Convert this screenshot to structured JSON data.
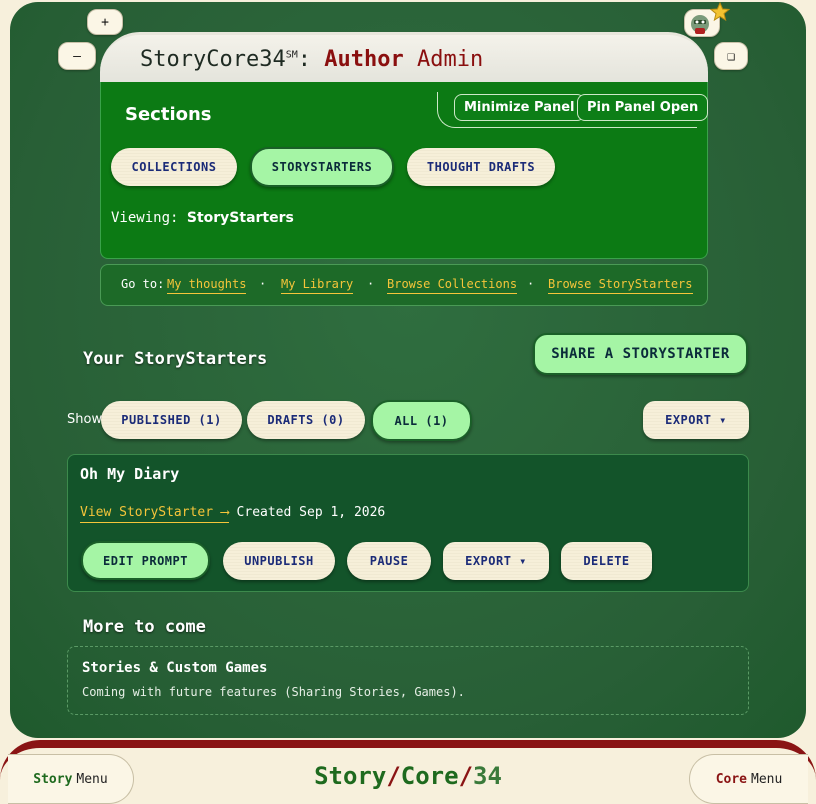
{
  "window": {
    "zoom_in": "+",
    "zoom_out": "–",
    "restore": "❑"
  },
  "header": {
    "brand": "StoryCore34",
    "brand_mark": "SM",
    "separator": ":",
    "role_word1": "Author",
    "role_word2": "Admin"
  },
  "panel": {
    "heading": "Sections",
    "minimize_label": "Minimize Panel",
    "pin_label": "Pin Panel Open",
    "tabs": [
      {
        "label": "COLLECTIONS",
        "active": false
      },
      {
        "label": "STORYSTARTERS",
        "active": true
      },
      {
        "label": "THOUGHT DRAFTS",
        "active": false
      }
    ],
    "viewing_label": "Viewing:",
    "viewing_value": "StoryStarters"
  },
  "goto": {
    "label": "Go to:",
    "links": [
      "My thoughts",
      "My Library",
      "Browse Collections",
      "Browse StoryStarters"
    ],
    "sep": "·"
  },
  "storystarters": {
    "heading": "Your StoryStarters",
    "share_label": "SHARE A STORYSTARTER",
    "show_label": "Show",
    "filters": [
      {
        "label": "PUBLISHED (1)",
        "active": false
      },
      {
        "label": "DRAFTS (0)",
        "active": false
      },
      {
        "label": "ALL (1)",
        "active": true
      }
    ],
    "export_label": "EXPORT ▾",
    "items": [
      {
        "title": "Oh My Diary",
        "view_link": "View StoryStarter ⟶",
        "created": "Created Sep 1, 2026",
        "actions": {
          "edit": "EDIT PROMPT",
          "unpublish": "UNPUBLISH",
          "pause": "PAUSE",
          "export": "EXPORT ▾",
          "delete": "DELETE"
        }
      }
    ]
  },
  "more": {
    "heading": "More to come",
    "card_title": "Stories & Custom Games",
    "card_desc": "Coming with future features (Sharing Stories, Games)."
  },
  "footer": {
    "left_word": "Story",
    "left_menu": "Menu",
    "brand_a": "Story",
    "brand_b": "Core",
    "brand_c": "34",
    "brand_slash": "/",
    "right_word": "Core",
    "right_menu": "Menu"
  },
  "colors": {
    "panel_green": "#0c7a14",
    "active_pill": "#a5f5a5",
    "link_gold": "#f5c53a",
    "accent_red": "#8a0f0f"
  }
}
